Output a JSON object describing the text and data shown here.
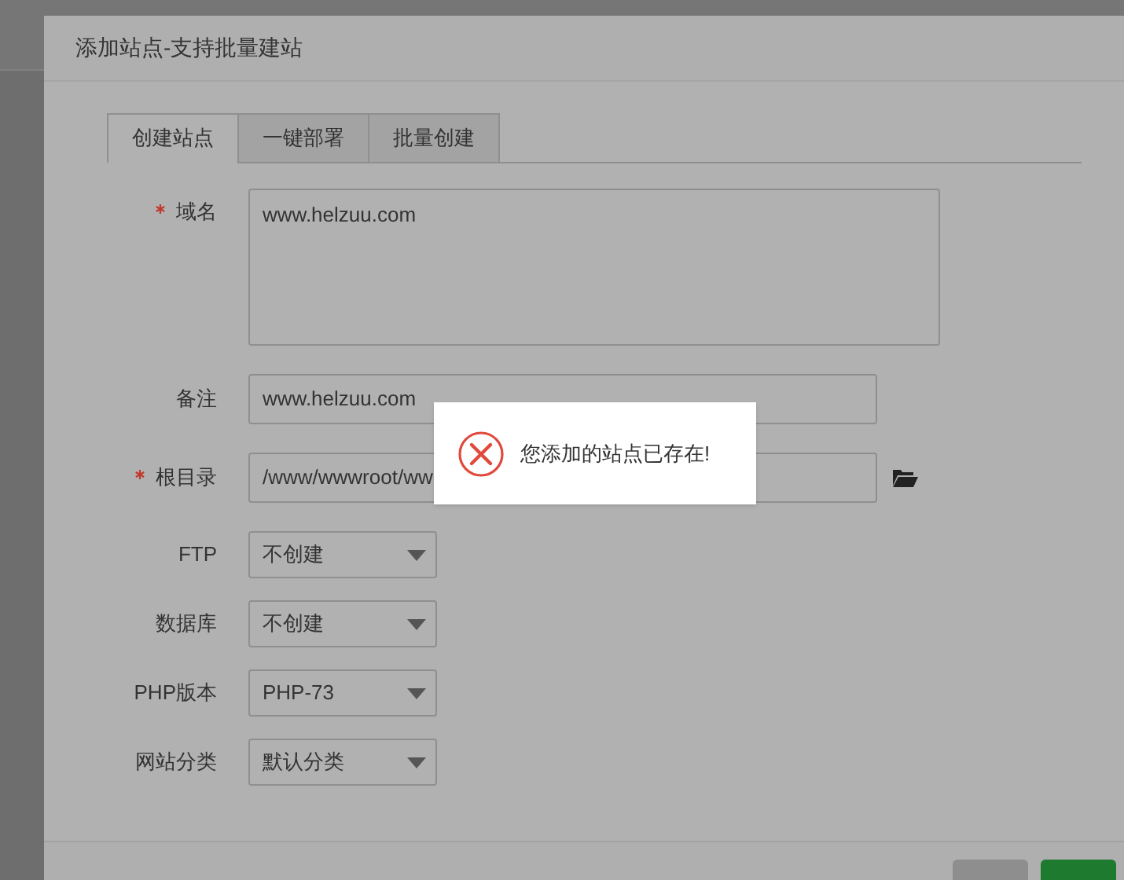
{
  "dialog": {
    "title": "添加站点-支持批量建站",
    "tabs": [
      {
        "label": "创建站点",
        "selected": true
      },
      {
        "label": "一键部署",
        "selected": false
      },
      {
        "label": "批量创建",
        "selected": false
      }
    ],
    "fields": [
      {
        "kind": "textarea",
        "label": "域名",
        "required": true,
        "value": "www.helzuu.com"
      },
      {
        "kind": "text",
        "label": "备注",
        "required": false,
        "value": "www.helzuu.com"
      },
      {
        "kind": "path",
        "label": "根目录",
        "required": true,
        "value": "/www/wwwroot/ww"
      },
      {
        "kind": "select",
        "label": "FTP",
        "required": false,
        "value": "不创建"
      },
      {
        "kind": "select",
        "label": "数据库",
        "required": false,
        "value": "不创建"
      },
      {
        "kind": "select",
        "label": "PHP版本",
        "required": false,
        "value": "PHP-73"
      },
      {
        "kind": "select",
        "label": "网站分类",
        "required": false,
        "value": "默认分类"
      }
    ],
    "buttons": [
      {
        "kind": "cancel"
      },
      {
        "kind": "submit"
      }
    ]
  },
  "toast": {
    "kind": "error",
    "message": "您添加的站点已存在!"
  }
}
